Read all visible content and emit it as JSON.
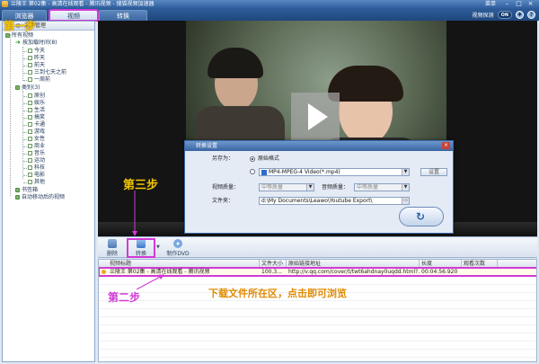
{
  "window": {
    "title": "兰陵王 第02集 - 高清在线观看 - 腾讯视频 - 搜狐视频加速器",
    "menu_label": "菜单",
    "minimize": "–",
    "maximize": "□",
    "close": "×"
  },
  "tabs": [
    {
      "label": "浏览器"
    },
    {
      "label": "视频"
    },
    {
      "label": "转换"
    }
  ],
  "header_right": {
    "detect_label": "视频探测",
    "toggle_value": "ON"
  },
  "sidebar": {
    "head_label": "文件管理",
    "tree": {
      "all_videos": "所有视频",
      "by_time": "按加载时间(8)",
      "time_items": [
        "今天",
        "昨天",
        "前天",
        "三到七天之前",
        "一周前"
      ],
      "by_category": "类别(3)",
      "category_items": [
        "原创",
        "娱乐",
        "生活",
        "搞笑",
        "卡通",
        "游戏",
        "女性",
        "商业",
        "音乐",
        "运动",
        "科技",
        "电影",
        "其他"
      ],
      "bookmarks": "书签箱",
      "auto_moved": "自动移动后的视频"
    }
  },
  "dialog": {
    "title": "转换设置",
    "save_as_label": "另存为：",
    "original_format": "原始格式",
    "format_value": "MP4-MPEG-4 Video(*.mp4)",
    "settings_button": "设置",
    "video_quality_label": "视频质量：",
    "video_quality_value": "中等质量",
    "audio_quality_label": "音频质量：",
    "audio_quality_value": "中等质量",
    "folder_label": "文件夹：",
    "folder_value": "d:\\My Documents\\Leawo\\Youtube Export\\"
  },
  "toolbar": {
    "delete_label": "删除",
    "convert_label": "转换",
    "dvd_label": "制作DVD"
  },
  "table": {
    "columns": [
      "视频标题",
      "文件大小",
      "原始链接地址",
      "长度",
      "观看次数"
    ],
    "rows": [
      {
        "title": "兰陵王 第02集 - 高清在线观看 - 腾讯视频",
        "size": "100.3...",
        "url": "http://v.qq.com/cover/t/twt6ahdnay0uqdd.html?...",
        "length": "00:04:56.920",
        "views": ""
      }
    ]
  },
  "annotations": {
    "step1": "第一步",
    "step2": "第二步",
    "step3": "第三步",
    "note": "下载文件所在区，点击即可浏览"
  },
  "colors": {
    "annotation": "#d13ad6",
    "step_text": "#f2c400",
    "note_text": "#e08a00"
  }
}
